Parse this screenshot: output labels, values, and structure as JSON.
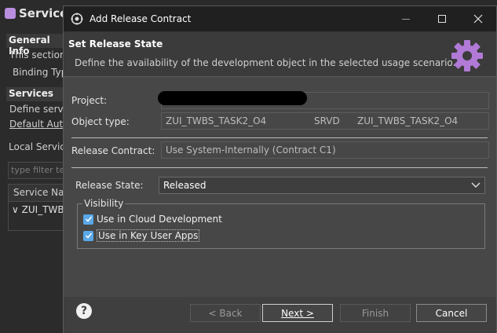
{
  "background": {
    "title": "Service",
    "general_section": "General Info",
    "general_text": "This section d",
    "binding_label": "Binding Typ",
    "services_section": "Services",
    "services_text": "Define servic",
    "default_link": "Default Auth",
    "local_service": "Local Service",
    "filter_placeholder": "type filter te",
    "table_header": "Service Nar",
    "table_row": "ZUI_TWB"
  },
  "dialog": {
    "title": "Add Release Contract",
    "header_title": "Set Release State",
    "header_desc": "Define the availability of the development object in the selected usage scenario.",
    "project_label": "Project:",
    "object_type_label": "Object type:",
    "object_type_value1": "ZUI_TWBS_TASK2_O4",
    "object_type_value2": "SRVD",
    "object_type_value3": "ZUI_TWBS_TASK2_O4",
    "release_contract_label": "Release Contract:",
    "release_contract_value": "Use System-Internally (Contract C1)",
    "release_state_label": "Release State:",
    "release_state_value": "Released",
    "visibility_label": "Visibility",
    "check_cloud": "Use in Cloud Development",
    "check_key_user": "Use in Key User Apps",
    "back_button": "< Back",
    "next_button": "Next >",
    "finish_button": "Finish",
    "cancel_button": "Cancel"
  },
  "colors": {
    "accent": "#5aa8e8",
    "dialog_bg": "#474747",
    "titlebar_bg": "#202020"
  }
}
